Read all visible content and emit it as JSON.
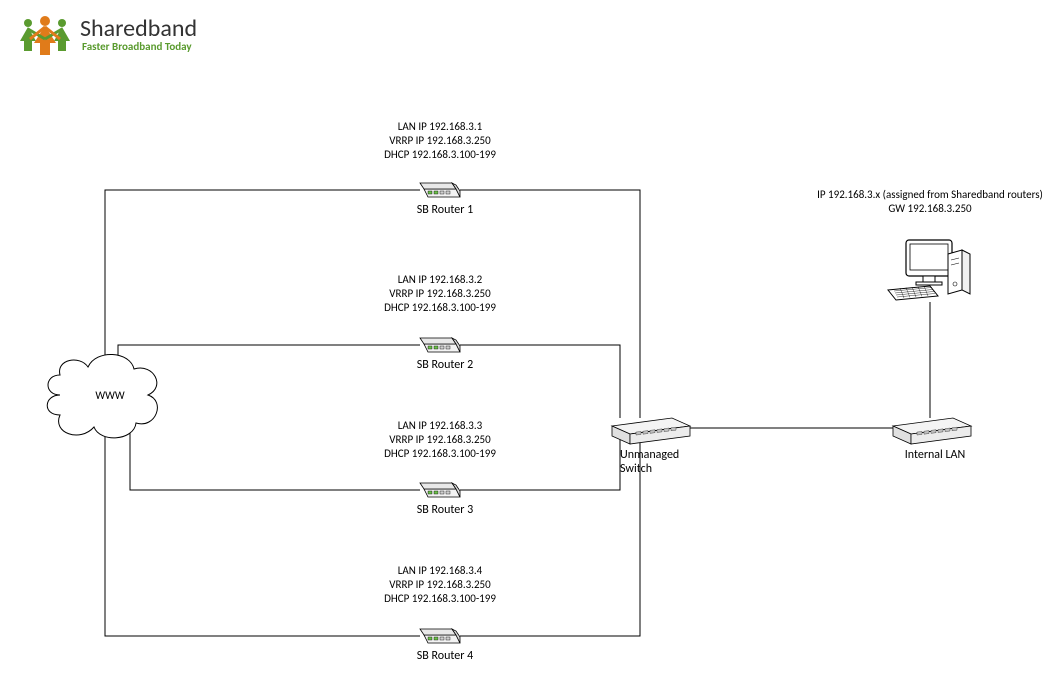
{
  "logo": {
    "brand": "Sharedband",
    "tagline": "Faster Broadband Today"
  },
  "cloud": {
    "label": "WWW"
  },
  "routers": [
    {
      "name": "SB Router 1",
      "lan_ip": "LAN IP 192.168.3.1",
      "vrrp_ip": "VRRP IP 192.168.3.250",
      "dhcp": "DHCP 192.168.3.100-199"
    },
    {
      "name": "SB Router 2",
      "lan_ip": "LAN IP 192.168.3.2",
      "vrrp_ip": "VRRP IP 192.168.3.250",
      "dhcp": "DHCP 192.168.3.100-199"
    },
    {
      "name": "SB Router 3",
      "lan_ip": "LAN IP 192.168.3.3",
      "vrrp_ip": "VRRP IP 192.168.3.250",
      "dhcp": "DHCP 192.168.3.100-199"
    },
    {
      "name": "SB Router 4",
      "lan_ip": "LAN IP 192.168.3.4",
      "vrrp_ip": "VRRP IP 192.168.3.250",
      "dhcp": "DHCP 192.168.3.100-199"
    }
  ],
  "switch": {
    "label": "Unmanaged Switch"
  },
  "lan_switch": {
    "label": "Internal LAN"
  },
  "pc": {
    "ip": "IP 192.168.3.x (assigned from Sharedband routers)",
    "gw": "GW 192.168.3.250"
  }
}
